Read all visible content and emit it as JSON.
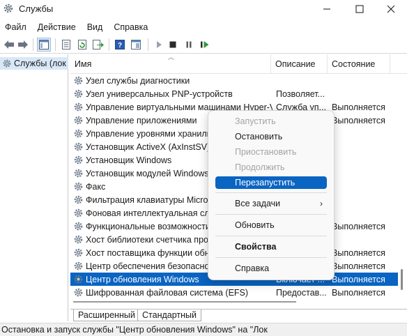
{
  "window": {
    "title": "Службы",
    "minimize_icon": "minimize-icon",
    "maximize_icon": "maximize-icon",
    "close_icon": "close-icon"
  },
  "menu": [
    "Файл",
    "Действие",
    "Вид",
    "Справка"
  ],
  "toolbar": {
    "buttons": [
      "back-arrow-icon",
      "forward-arrow-icon",
      "console-tree-icon",
      "properties-list-icon",
      "refresh-icon",
      "export-icon",
      "help-icon",
      "view-icon",
      "start-icon",
      "stop-icon",
      "pause-icon",
      "restart-icon"
    ]
  },
  "tree": {
    "item_label": "Службы (лок"
  },
  "table": {
    "columns": {
      "name": "Имя",
      "description": "Описание",
      "state": "Состояние"
    },
    "rows": [
      {
        "name": "Узел службы диагностики",
        "description": "",
        "state": ""
      },
      {
        "name": "Узел универсальных PNP-устройств",
        "description": "Позволяет...",
        "state": ""
      },
      {
        "name": "Управление виртуальными машинами Hyper-V",
        "description": "Служба уп...",
        "state": "Выполняется"
      },
      {
        "name": "Управление приложениями",
        "description": "",
        "state": "Выполняется"
      },
      {
        "name": "Управление уровнями хранили",
        "description": "",
        "state": ""
      },
      {
        "name": "Установщик ActiveX (AxInstSV)",
        "description": "",
        "state": ""
      },
      {
        "name": "Установщик Windows",
        "description": "",
        "state": ""
      },
      {
        "name": "Установщик модулей Windows",
        "description": "",
        "state": ""
      },
      {
        "name": "Факс",
        "description": "",
        "state": ""
      },
      {
        "name": "Фильтрация клавиатуры Micros",
        "description": "",
        "state": ""
      },
      {
        "name": "Фоновая интеллектуальная служ",
        "description": "",
        "state": ""
      },
      {
        "name": "Функциональные возможности",
        "description": "",
        "state": "Выполняется"
      },
      {
        "name": "Хост библиотеки счетчика прои",
        "description": "",
        "state": ""
      },
      {
        "name": "Хост поставщика функции обна",
        "description": "",
        "state": "Выполняется"
      },
      {
        "name": "Центр обеспечения безопаснос",
        "description": "",
        "state": "Выполняется"
      },
      {
        "name": "Центр обновления Windows",
        "description": "Включает ...",
        "state": "Выполняется",
        "selected": true
      },
      {
        "name": "Шифрованная файловая система (EFS)",
        "description": "Предостав...",
        "state": "Выполняется"
      }
    ]
  },
  "tabs": [
    "Расширенный",
    "Стандартный"
  ],
  "status": "Остановка и запуск службы \"Центр обновления Windows\" на \"Лок",
  "context_menu": {
    "start": "Запустить",
    "stop": "Остановить",
    "pause": "Приостановить",
    "resume": "Продолжить",
    "restart": "Перезапустить",
    "all_tasks": "Все задачи",
    "refresh": "Обновить",
    "properties": "Свойства",
    "help": "Справка"
  },
  "colors": {
    "selection": "#0a64c2",
    "tree_selection": "#d9e8f7"
  }
}
